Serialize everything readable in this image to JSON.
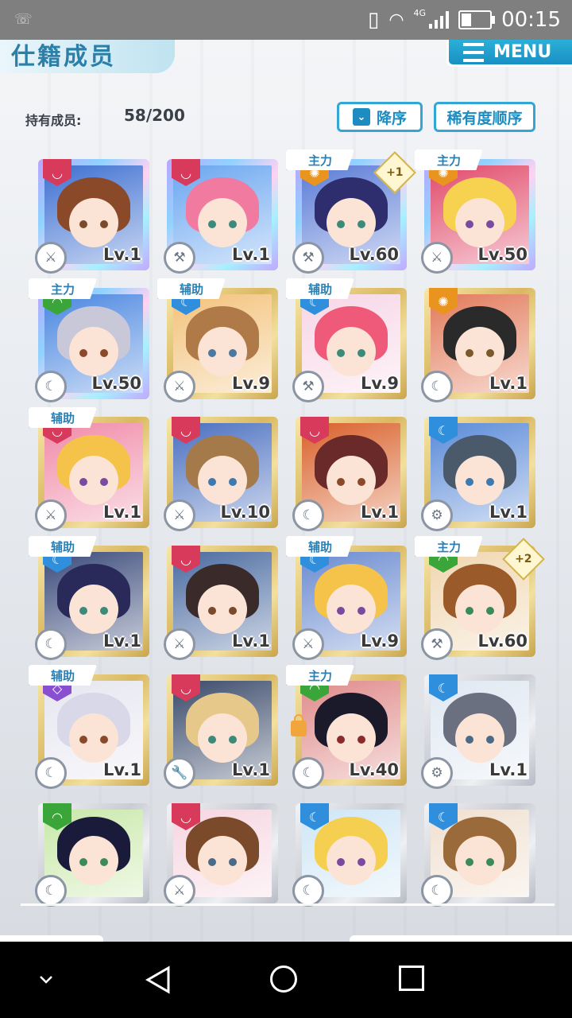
{
  "status_bar": {
    "time": "00:15",
    "network": "4G",
    "battery_level": 0.35
  },
  "header": {
    "title": "仕籍成员",
    "menu_label": "MENU"
  },
  "members": {
    "count_label": "持有成员:",
    "count_value": "58/200"
  },
  "sort": {
    "order_label": "降序",
    "by_label": "稀有度顺序"
  },
  "colors": {
    "accent": "#1d8cc0",
    "gold_frame": "#d9b860",
    "rainbow_frame": "#8fd3ff",
    "silver_frame": "#c9ccd3"
  },
  "cards": [
    {
      "frame": "rainbow",
      "attr": "red",
      "role": "",
      "plus": "",
      "level": "Lv.1",
      "weapon": "sword-icon",
      "hair": "#8a4a2a",
      "bg": "#3d6fd1",
      "eye": "#7a4a2a"
    },
    {
      "frame": "rainbow",
      "attr": "red",
      "role": "",
      "plus": "",
      "level": "Lv.1",
      "weapon": "hammer-icon",
      "hair": "#f07aa0",
      "bg": "#6aa6f0",
      "eye": "#3c8a7a"
    },
    {
      "frame": "rainbow",
      "attr": "orange",
      "role": "主力",
      "plus": "+1",
      "level": "Lv.60",
      "weapon": "hammer-icon",
      "hair": "#2e2e6e",
      "bg": "#5a7bd6",
      "eye": "#3c8a7a"
    },
    {
      "frame": "rainbow",
      "attr": "orange",
      "role": "主力",
      "plus": "",
      "level": "Lv.50",
      "weapon": "sword-icon",
      "hair": "#f6d250",
      "bg": "#e14a6a",
      "eye": "#7a4aa0"
    },
    {
      "frame": "rainbow",
      "attr": "green",
      "role": "主力",
      "plus": "",
      "level": "Lv.50",
      "weapon": "scythe-icon",
      "hair": "#c8c8d8",
      "bg": "#4a86e0",
      "eye": "#8a4a2a"
    },
    {
      "frame": "gold",
      "attr": "blue",
      "role": "辅助",
      "plus": "",
      "level": "Lv.9",
      "weapon": "sword-icon",
      "hair": "#b07a48",
      "bg": "#f3c27a",
      "eye": "#4a78a0"
    },
    {
      "frame": "gold",
      "attr": "blue",
      "role": "辅助",
      "plus": "",
      "level": "Lv.9",
      "weapon": "hammer-icon",
      "hair": "#f05a7a",
      "bg": "#f7d6e6",
      "eye": "#3c8a7a"
    },
    {
      "frame": "gold",
      "attr": "orange",
      "role": "",
      "plus": "",
      "level": "Lv.1",
      "weapon": "scythe-icon",
      "hair": "#2a2a2a",
      "bg": "#e27a5a",
      "eye": "#7a5a2a"
    },
    {
      "frame": "gold",
      "attr": "red",
      "role": "辅助",
      "plus": "",
      "level": "Lv.1",
      "weapon": "sword-icon",
      "hair": "#f5c34a",
      "bg": "#f08aa8",
      "eye": "#7a4aa0"
    },
    {
      "frame": "gold",
      "attr": "red",
      "role": "",
      "plus": "",
      "level": "Lv.10",
      "weapon": "sword-icon",
      "hair": "#a57a4a",
      "bg": "#4a6fc0",
      "eye": "#3c7ab0"
    },
    {
      "frame": "gold",
      "attr": "red",
      "role": "",
      "plus": "",
      "level": "Lv.1",
      "weapon": "scythe-icon",
      "hair": "#6a2a2a",
      "bg": "#d9602a",
      "eye": "#8a4a2a"
    },
    {
      "frame": "gold",
      "attr": "blue",
      "role": "",
      "plus": "",
      "level": "Lv.1",
      "weapon": "gear-icon",
      "hair": "#4a5a6a",
      "bg": "#5a8ad8",
      "eye": "#3c7ab0"
    },
    {
      "frame": "gold",
      "attr": "blue",
      "role": "辅助",
      "plus": "",
      "level": "Lv.1",
      "weapon": "scythe-icon",
      "hair": "#2a2a5a",
      "bg": "#3a4a7a",
      "eye": "#3c8a7a"
    },
    {
      "frame": "gold",
      "attr": "red",
      "role": "",
      "plus": "",
      "level": "Lv.1",
      "weapon": "sword-icon",
      "hair": "#3a2a2a",
      "bg": "#4a6aa0",
      "eye": "#7a4a2a"
    },
    {
      "frame": "gold",
      "attr": "blue",
      "role": "辅助",
      "plus": "",
      "level": "Lv.9",
      "weapon": "sword-icon",
      "hair": "#f5c34a",
      "bg": "#6a8ad0",
      "eye": "#7a4aa0"
    },
    {
      "frame": "gold",
      "attr": "green",
      "role": "主力",
      "plus": "+2",
      "level": "Lv.60",
      "weapon": "hammer-icon",
      "hair": "#9a5a2a",
      "bg": "#f0d6b0",
      "eye": "#3c8a5a"
    },
    {
      "frame": "gold",
      "attr": "purple",
      "role": "辅助",
      "plus": "",
      "level": "Lv.1",
      "weapon": "scythe-icon",
      "hair": "#d8d8e8",
      "bg": "#e6e6f0",
      "eye": "#8a4a2a"
    },
    {
      "frame": "gold",
      "attr": "red",
      "role": "",
      "plus": "",
      "level": "Lv.1",
      "weapon": "wrench-icon",
      "hair": "#e6c98a",
      "bg": "#3a4a6a",
      "eye": "#3c8a7a"
    },
    {
      "frame": "gold",
      "attr": "green",
      "role": "主力",
      "plus": "",
      "level": "Lv.40",
      "weapon": "scythe-icon",
      "hair": "#1a1a2a",
      "bg": "#e08a8a",
      "eye": "#8a2a2a",
      "locked": true
    },
    {
      "frame": "silver",
      "attr": "blue",
      "role": "",
      "plus": "",
      "level": "Lv.1",
      "weapon": "gear-icon",
      "hair": "#6a7080",
      "bg": "#dfe8f2",
      "eye": "#4a6a8a"
    },
    {
      "frame": "silver",
      "attr": "green",
      "role": "",
      "plus": "",
      "level": "",
      "weapon": "scythe-icon",
      "hair": "#1a1a3a",
      "bg": "#c8e8a8",
      "eye": "#3c8a5a"
    },
    {
      "frame": "silver",
      "attr": "red",
      "role": "",
      "plus": "",
      "level": "",
      "weapon": "sword-icon",
      "hair": "#7a4a2a",
      "bg": "#f6d6e0",
      "eye": "#4a6a8a"
    },
    {
      "frame": "silver",
      "attr": "blue",
      "role": "",
      "plus": "",
      "level": "",
      "weapon": "scythe-icon",
      "hair": "#f5d050",
      "bg": "#cfe6f6",
      "eye": "#7a4aa0"
    },
    {
      "frame": "silver",
      "attr": "blue",
      "role": "",
      "plus": "",
      "level": "",
      "weapon": "scythe-icon",
      "hair": "#9a6a3a",
      "bg": "#f0e0d0",
      "eye": "#3c8a5a"
    }
  ]
}
